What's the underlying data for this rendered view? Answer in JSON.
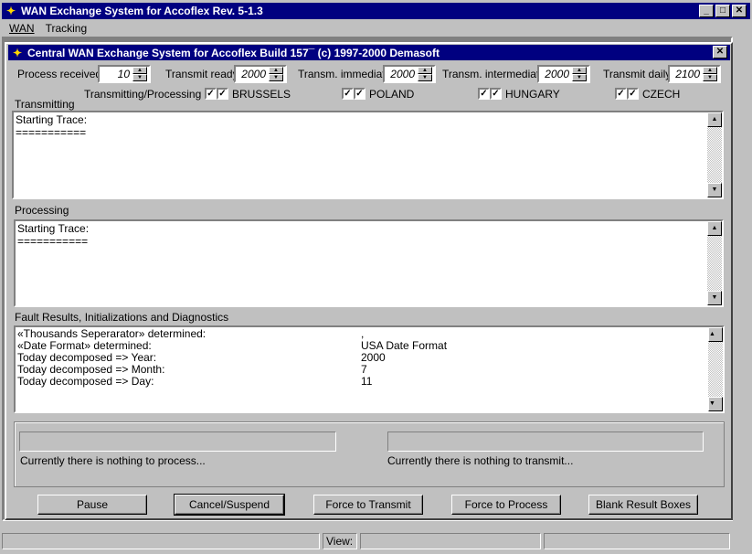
{
  "window": {
    "title": "WAN Exchange System for Accoflex Rev. 5-1.3",
    "min": "_",
    "max": "□",
    "close": "✕"
  },
  "menu": [
    {
      "label": "WAN"
    },
    {
      "label": "Tracking"
    }
  ],
  "child": {
    "title": "Central WAN Exchange System for Accoflex  Build 157¯ (c) 1997-2000 Demasoft",
    "close": "✕"
  },
  "settings": {
    "process_received": {
      "label": "Process received",
      "value": "10"
    },
    "transmit_ready": {
      "label": "Transmit ready",
      "value": "2000"
    },
    "transm_immediate": {
      "label": "Transm. immediate",
      "value": "2000"
    },
    "transm_intermediate": {
      "label": "Transm. intermediate",
      "value": "2000"
    },
    "transmit_daily": {
      "label": "Transmit daily",
      "value": "2100"
    }
  },
  "countries": {
    "header": "Transmitting/Processing =>",
    "items": [
      {
        "name": "BRUSSELS"
      },
      {
        "name": "POLAND"
      },
      {
        "name": "HUNGARY"
      },
      {
        "name": "CZECH"
      }
    ],
    "check": "✓"
  },
  "transmitting": {
    "label": "Transmitting",
    "lines": [
      "Starting Trace:",
      "==========="
    ]
  },
  "processing": {
    "label": "Processing",
    "lines": [
      "Starting Trace:",
      "==========="
    ]
  },
  "diagnostics": {
    "label": "Fault Results, Initializations and Diagnostics",
    "rows": [
      {
        "k": "«Thousands Seperarator» determined:",
        "v": ","
      },
      {
        "k": "«Date Format» determined:",
        "v": "USA Date Format"
      },
      {
        "k": "Today decomposed => Year:",
        "v": "2000"
      },
      {
        "k": "Today decomposed => Month:",
        "v": "7"
      },
      {
        "k": "Today decomposed => Day:",
        "v": "11"
      }
    ]
  },
  "status": {
    "process_msg": "Currently there is nothing to process...",
    "transmit_msg": "Currently there is nothing to transmit..."
  },
  "buttons": {
    "pause": "Pause",
    "cancel": "Cancel/Suspend",
    "force_transmit": "Force to Transmit",
    "force_process": "Force to Process",
    "blank": "Blank Result Boxes"
  },
  "statusbar": {
    "view": "View:"
  },
  "icons": {
    "up": "▲",
    "down": "▼",
    "app": "✦"
  }
}
